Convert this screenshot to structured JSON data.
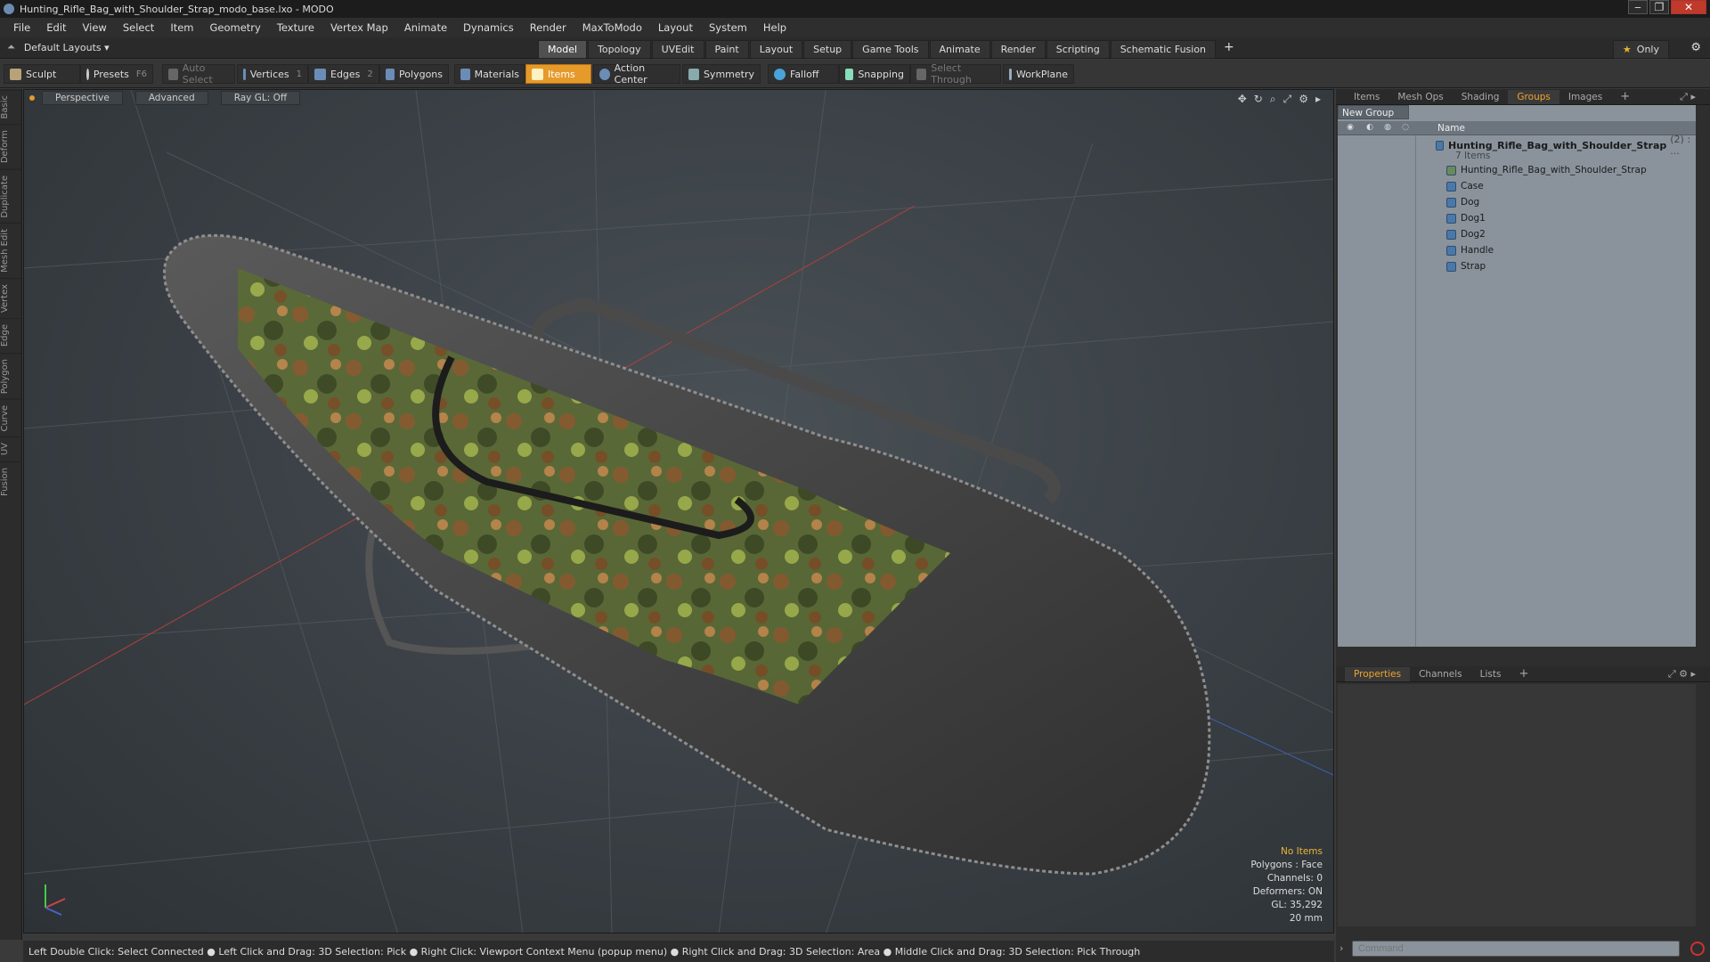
{
  "window": {
    "title": "Hunting_Rifle_Bag_with_Shoulder_Strap_modo_base.lxo - MODO",
    "minimize": "‒",
    "maximize": "❐",
    "close": "✕"
  },
  "menu": [
    "File",
    "Edit",
    "View",
    "Select",
    "Item",
    "Geometry",
    "Texture",
    "Vertex Map",
    "Animate",
    "Dynamics",
    "Render",
    "MaxToModo",
    "Layout",
    "System",
    "Help"
  ],
  "layoutbar": {
    "layouts_label": "Default Layouts ▾",
    "tabs": [
      "Model",
      "Topology",
      "UVEdit",
      "Paint",
      "Layout",
      "Setup",
      "Game Tools",
      "Animate",
      "Render",
      "Scripting",
      "Schematic Fusion"
    ],
    "active_tab": "Model",
    "plus": "+",
    "only_label": "Only",
    "star": "★",
    "gear": "⚙"
  },
  "toolbar": {
    "sculpt": "Sculpt",
    "presets": "Presets",
    "presets_key": "F6",
    "auto_select": "Auto Select",
    "vertices": "Vertices",
    "vertices_count": "1",
    "edges": "Edges",
    "edges_count": "2",
    "polygons": "Polygons",
    "materials": "Materials",
    "items": "Items",
    "action_center": "Action Center",
    "symmetry": "Symmetry",
    "falloff": "Falloff",
    "snapping": "Snapping",
    "select_through": "Select Through",
    "workplane": "WorkPlane"
  },
  "lefttabs": [
    "Basic",
    "Deform",
    "Duplicate",
    "Mesh Edit",
    "Vertex",
    "Edge",
    "Polygon",
    "Curve",
    "UV",
    "Fusion"
  ],
  "viewport": {
    "view": "Perspective",
    "shading": "Advanced",
    "raygl": "Ray GL: Off",
    "info": {
      "items": "No Items",
      "polygons": "Polygons : Face",
      "channels": "Channels: 0",
      "deformers": "Deformers: ON",
      "gl": "GL: 35,292",
      "scale": "20 mm"
    }
  },
  "statusbar": "Left Double Click: Select Connected ● Left Click and Drag: 3D Selection: Pick ● Right Click: Viewport Context Menu (popup menu) ● Right Click and Drag: 3D Selection: Area ● Middle Click and Drag: 3D Selection: Pick Through",
  "rightpanel": {
    "top_tabs": [
      "Items",
      "Mesh Ops",
      "Shading",
      "Groups",
      "Images"
    ],
    "active_top_tab": "Groups",
    "new_group": "New Group",
    "name_header": "Name",
    "group": {
      "name": "Hunting_Rifle_Bag_with_Shoulder_Strap",
      "count": "(2) : ...",
      "subtitle": "7 Items",
      "children": [
        "Hunting_Rifle_Bag_with_Shoulder_Strap",
        "Case",
        "Dog",
        "Dog1",
        "Dog2",
        "Handle",
        "Strap"
      ]
    },
    "bottom_tabs": [
      "Properties",
      "Channels",
      "Lists"
    ],
    "active_bottom_tab": "Properties",
    "command_placeholder": "Command"
  }
}
